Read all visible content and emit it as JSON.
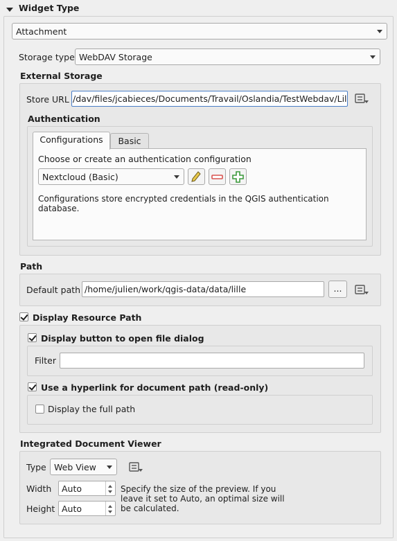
{
  "widget_type": {
    "title": "Widget Type",
    "selected": "Attachment"
  },
  "storage_type": {
    "label": "Storage type",
    "selected": "WebDAV Storage"
  },
  "external_storage": {
    "title": "External Storage",
    "store_url_label": "Store URL",
    "store_url_value": "/dav/files/jcabieces/Documents/Travail/Oslandia/TestWebdav/Lille/",
    "authentication": {
      "title": "Authentication",
      "tabs": [
        "Configurations",
        "Basic"
      ],
      "active_tab": "Configurations",
      "choose_label": "Choose or create an authentication configuration",
      "selected_config": "Nextcloud (Basic)",
      "info_text_line1": "Configurations store encrypted credentials in the QGIS authentication",
      "info_text_line2": "database."
    }
  },
  "path": {
    "title": "Path",
    "default_path_label": "Default path",
    "default_path_value": "/home/julien/work/qgis-data/data/lille",
    "browse_label": "..."
  },
  "display_resource_path": {
    "label": "Display Resource Path",
    "checked": true,
    "display_button": {
      "label": "Display button to open file dialog",
      "checked": true,
      "filter_label": "Filter",
      "filter_value": ""
    },
    "hyperlink": {
      "label": "Use a hyperlink for document path (read-only)",
      "checked": true,
      "full_path_label": "Display the full path",
      "full_path_checked": false
    }
  },
  "viewer": {
    "title": "Integrated Document Viewer",
    "type_label": "Type",
    "type_selected": "Web View",
    "width_label": "Width",
    "width_value": "Auto",
    "height_label": "Height",
    "height_value": "Auto",
    "hint_line1": "Specify the size of the preview. If you",
    "hint_line2": "leave it set to Auto, an optimal size will",
    "hint_line3": "be calculated."
  },
  "icons": {
    "collapse": "triangle-down-icon",
    "data_defined": "data-defined-override-icon",
    "edit": "pencil-icon",
    "remove": "minus-icon",
    "add": "plus-icon"
  },
  "colors": {
    "background": "#efefef",
    "group_panel": "#e8e8e8",
    "remove_red": "#d9534f",
    "add_green": "#3c9a3c",
    "pencil_yellow": "#e8c84a"
  }
}
